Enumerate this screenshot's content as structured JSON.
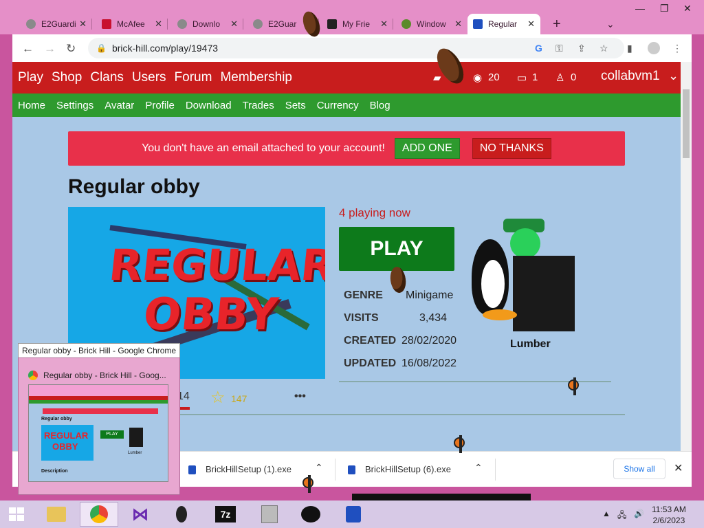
{
  "browser": {
    "tabs": [
      {
        "label": "E2Guardi"
      },
      {
        "label": "McAfee"
      },
      {
        "label": "Downlo"
      },
      {
        "label": "E2Guar"
      },
      {
        "label": "My Frie"
      },
      {
        "label": "Window"
      },
      {
        "label": "Regular"
      }
    ],
    "new_tab": "+",
    "url": "brick-hill.com/play/19473"
  },
  "site": {
    "top_nav": [
      "Play",
      "Shop",
      "Clans",
      "Users",
      "Forum",
      "Membership"
    ],
    "stats": {
      "bits": "20",
      "messages": "1",
      "friends": "0"
    },
    "username": "collabvm1",
    "sub_nav": [
      "Home",
      "Settings",
      "Avatar",
      "Profile",
      "Download",
      "Trades",
      "Sets",
      "Currency",
      "Blog"
    ],
    "banner": {
      "text": "You don't have an email attached to your account!",
      "add": "ADD ONE",
      "dismiss": "NO THANKS"
    },
    "game": {
      "title": "Regular obby",
      "thumb_line1": "REGULAR",
      "thumb_line2": "OBBY",
      "playing": "4 playing now",
      "play_label": "PLAY",
      "genre_label": "GENRE",
      "genre": "Minigame",
      "visits_label": "VISITS",
      "visits": "3,434",
      "created_label": "CREATED",
      "created": "28/02/2020",
      "updated_label": "UPDATED",
      "updated": "16/08/2022",
      "creator": "Lumber",
      "likes_count": "14",
      "favorites": "147",
      "more": "•••"
    }
  },
  "downloads": {
    "items": [
      {
        "name": "BrickHillSetup (1).exe"
      },
      {
        "name": "BrickHillSetup (6).exe"
      }
    ],
    "show_all": "Show all"
  },
  "taskbar": {
    "tooltip": "Regular obby - Brick Hill - Google Chrome",
    "preview_caption": "Regular obby - Brick Hill - Goog...",
    "preview_title": "Regular obby",
    "preview_play": "PLAY",
    "preview_creator": "Lumber",
    "preview_desc": "Description",
    "app_7z": "7z",
    "time": "11:53 AM",
    "date": "2/6/2023"
  }
}
